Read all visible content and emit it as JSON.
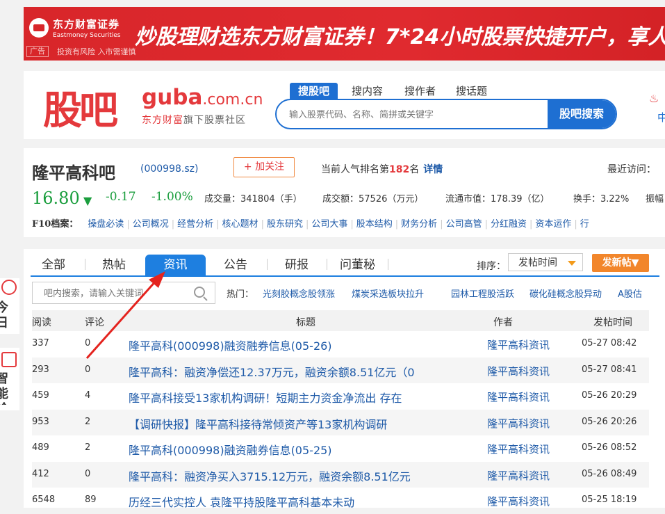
{
  "ad": {
    "brand_cn": "东方财富证券",
    "brand_en": "Eastmoney Securities",
    "slogan": "炒股理财选东方财富证券！7*24小时股票快捷开户，享人",
    "tag": "广告",
    "risk": "投资有风险 入市需谨慎"
  },
  "header": {
    "logo_cn": "股吧",
    "logo_en_main": "guba",
    "logo_en_domain": ".com.cn",
    "logo_sub_red": "东方财富",
    "logo_sub_rest": "旗下股票社区",
    "search_tabs": [
      "搜股吧",
      "搜内容",
      "搜作者",
      "搜话题"
    ],
    "search_placeholder": "输入股票代码、名称、简拼或关键字",
    "search_button": "股吧搜索",
    "hot_cut": "中"
  },
  "stock": {
    "bar_name": "隆平高科吧",
    "code": "(000998.sz)",
    "follow": "+ 加关注",
    "rank_prefix": "当前人气排名第",
    "rank_value": "182",
    "rank_suffix": "名",
    "rank_detail": "详情",
    "recent": "最近访问：",
    "price": "16.80",
    "change": "-0.17",
    "change_pct": "-1.00%",
    "volume": "成交量：341804（手）",
    "amount": "成交额：57526（万元）",
    "market_cap": "流通市值：178.39（亿）",
    "turnover": "换手：3.22%",
    "amplitude": "振幅",
    "f10_label": "F10档案：",
    "f10_items": [
      "操盘必读",
      "公司概况",
      "经营分析",
      "核心题材",
      "股东研究",
      "公司大事",
      "股本结构",
      "财务分析",
      "公司高管",
      "分红融资",
      "资本运作",
      "行"
    ]
  },
  "side": {
    "item1": "今日机会",
    "item2": "智能诊股"
  },
  "list": {
    "tabs": [
      "全部",
      "热帖",
      "资讯",
      "公告",
      "研报",
      "问董秘"
    ],
    "active_tab": "资讯",
    "sort_label": "排序：",
    "sort_value": "发帖时间",
    "post_button": "发新帖▼",
    "bar_search_placeholder": "吧内搜索，请输入关键词",
    "hot_label": "热门：",
    "hot_items": [
      "光刻胶概念股领涨",
      "煤炭采选板块拉升",
      "园林工程股活跃",
      "碳化硅概念股异动",
      "A股估"
    ],
    "columns": [
      "阅读",
      "评论",
      "标题",
      "作者",
      "发帖时间"
    ],
    "rows": [
      {
        "reads": "337",
        "comments": "0",
        "title": "隆平高科(000998)融资融券信息(05-26)",
        "author": "隆平高科资讯",
        "time": "05-27 08:42"
      },
      {
        "reads": "293",
        "comments": "0",
        "title": "隆平高科：融资净偿还12.37万元，融资余额8.51亿元（0",
        "author": "隆平高科资讯",
        "time": "05-27 08:41"
      },
      {
        "reads": "459",
        "comments": "4",
        "title": "隆平高科接受13家机构调研！短期主力资金净流出 存在",
        "author": "隆平高科资讯",
        "time": "05-26 20:29"
      },
      {
        "reads": "953",
        "comments": "2",
        "title": "【调研快报】隆平高科接待常倾资产等13家机构调研",
        "author": "隆平高科资讯",
        "time": "05-26 20:26"
      },
      {
        "reads": "489",
        "comments": "2",
        "title": "隆平高科(000998)融资融券信息(05-25)",
        "author": "隆平高科资讯",
        "time": "05-26 08:52"
      },
      {
        "reads": "412",
        "comments": "0",
        "title": "隆平高科：融资净买入3715.12万元，融资余额8.51亿元",
        "author": "隆平高科资讯",
        "time": "05-26 08:49"
      },
      {
        "reads": "6548",
        "comments": "89",
        "title": "历经三代实控人 袁隆平持股隆平高科基本未动",
        "author": "隆平高科资讯",
        "time": "05-25 18:19"
      }
    ]
  },
  "colors": {
    "brand_red": "#e4393c",
    "link_blue": "#1e5aa8",
    "tab_blue": "#1e7fe0",
    "down_green": "#1b9e3e",
    "post_orange": "#f2862b"
  }
}
